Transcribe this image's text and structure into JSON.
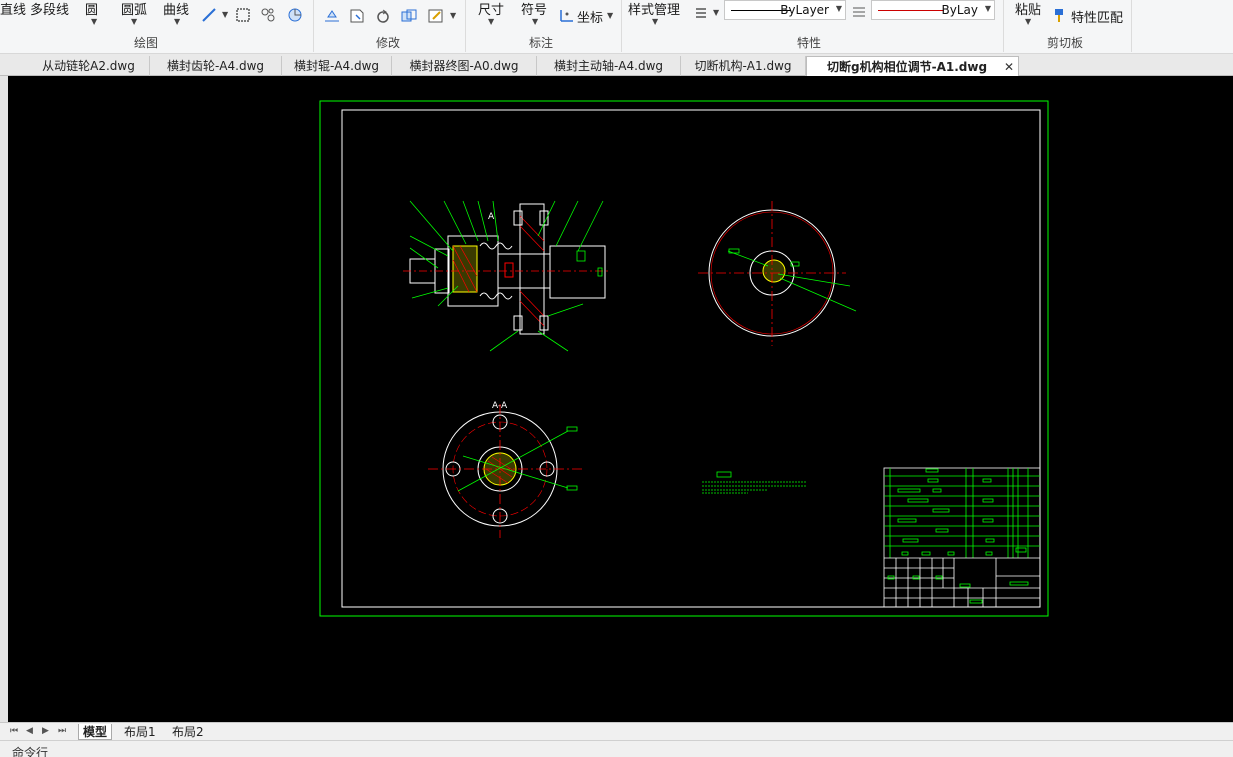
{
  "ribbon": {
    "draw": {
      "line": "直线",
      "polyline": "多段线",
      "circle": "圆",
      "arc": "圆弧",
      "curve": "曲线",
      "group_label": "绘图"
    },
    "modify": {
      "group_label": "修改"
    },
    "annotation": {
      "dimension": "尺寸",
      "symbol": "符号",
      "coordinate": "坐标",
      "group_label": "标注"
    },
    "properties": {
      "style_manager": "样式管理",
      "linetype_value": "ByLayer",
      "color_value": "ByLay",
      "group_label": "特性"
    },
    "clipboard": {
      "paste": "粘贴",
      "match_properties": "特性匹配",
      "group_label": "剪切板"
    }
  },
  "tabs": [
    {
      "label": "从动链轮A2.dwg"
    },
    {
      "label": "横封齿轮-A4.dwg"
    },
    {
      "label": "横封辊-A4.dwg"
    },
    {
      "label": "横封器终图-A0.dwg"
    },
    {
      "label": "横封主动轴-A4.dwg"
    },
    {
      "label": "切断机构-A1.dwg"
    },
    {
      "label": "切断g机构相位调节-A1.dwg",
      "active": true
    }
  ],
  "layout_tabs": [
    {
      "label": "模型",
      "active": true
    },
    {
      "label": "布局1"
    },
    {
      "label": "布局2"
    }
  ],
  "drawing": {
    "section_label_a": "A",
    "section_title": "A-A"
  },
  "command_line": "命令行",
  "colors": {
    "canvas_bg": "#000000",
    "frame_green": "#00ff00",
    "border_white": "#ffffff",
    "center_red": "#ff0000",
    "linetype_color": "#000000",
    "color_line": "#cc0000"
  },
  "icons": [
    "line-icon",
    "rect-icon",
    "hatch-icon",
    "mirror-icon",
    "move-icon",
    "rotate-icon",
    "copy-icon",
    "properties-icon",
    "coordinate-icon",
    "layer-icon",
    "paste-icon",
    "match-properties-icon",
    "close-icon"
  ]
}
